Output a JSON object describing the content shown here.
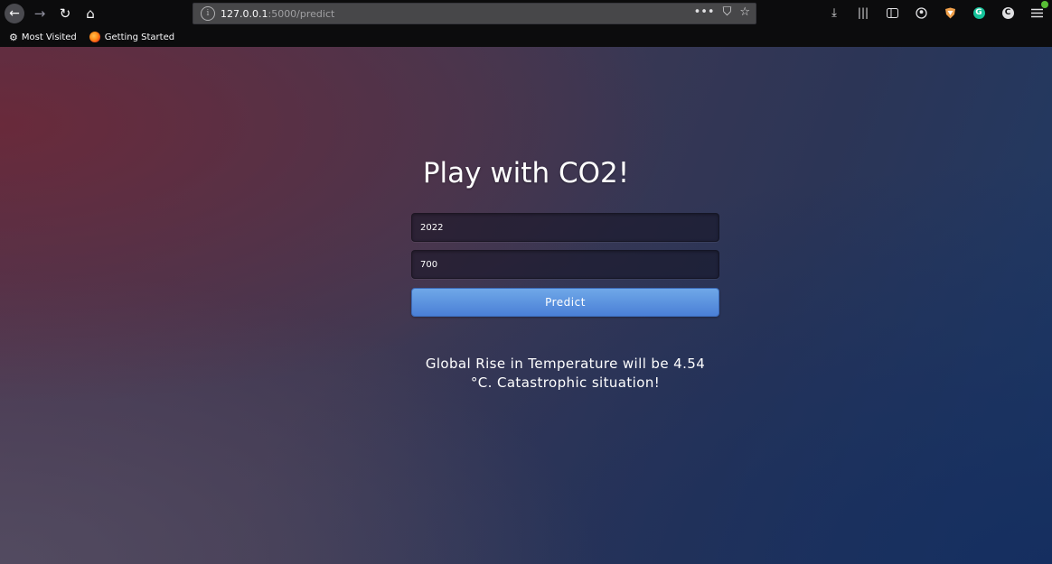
{
  "browser": {
    "url_host": "127.0.0.1",
    "url_path": ":5000/predict",
    "url_actions": [
      "•••",
      "⛉",
      "☆"
    ],
    "bookmarks": [
      {
        "label": "Most Visited",
        "icon": "gear-icon"
      },
      {
        "label": "Getting Started",
        "icon": "firefox-icon"
      }
    ]
  },
  "page": {
    "title": "Play with CO2!",
    "year_input_value": "2022",
    "co2_input_value": "700",
    "predict_label": "Predict",
    "result_line1": "Global Rise in Temperature will be 4.54",
    "result_line2": "°C. Catastrophic situation!"
  },
  "colors": {
    "button_top": "#6fa8e8",
    "button_bottom": "#4a7fd6",
    "chrome_bg": "#0c0c0d"
  }
}
